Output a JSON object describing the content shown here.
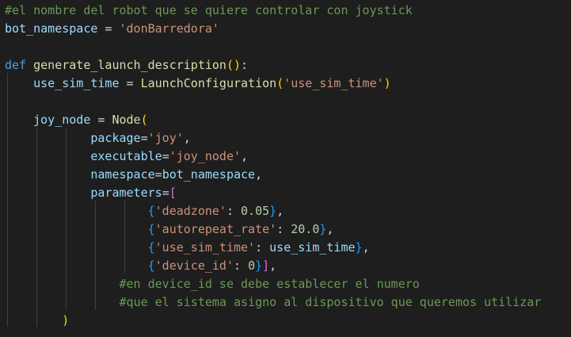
{
  "colors": {
    "background": "#1e1e1e",
    "keyword": "#569cd6",
    "function": "#dcdcaa",
    "variable": "#9cdcfe",
    "string": "#ce9178",
    "number": "#b5cea8",
    "comment": "#6a9955",
    "bracket_level_1": "#ffd700",
    "bracket_level_2": "#da70d6",
    "bracket_level_3": "#179fff"
  },
  "code": {
    "l1_comment": "#el nombre del robot que se quiere controlar con joystick",
    "l2_var": "bot_namespace",
    "l2_eq": " = ",
    "l2_str": "'donBarredora'",
    "l4_kw": "def",
    "l4_sp": " ",
    "l4_fn": "generate_launch_description",
    "l4_open": "(",
    "l4_close": ")",
    "l4_colon": ":",
    "l5_indent": "    ",
    "l5_var": "use_sim_time",
    "l5_eq": " = ",
    "l5_fn": "LaunchConfiguration",
    "l5_open": "(",
    "l5_str": "'use_sim_time'",
    "l5_close": ")",
    "l7_indent": "    ",
    "l7_var": "joy_node",
    "l7_eq": " = ",
    "l7_fn": "Node",
    "l7_open": "(",
    "l8_indent": "            ",
    "l8_var": "package",
    "l8_eq": "=",
    "l8_str": "'joy'",
    "l8_comma": ",",
    "l9_indent": "            ",
    "l9_var": "executable",
    "l9_eq": "=",
    "l9_str": "'joy_node'",
    "l9_comma": ",",
    "l10_indent": "            ",
    "l10_var": "namespace",
    "l10_eq": "=",
    "l10_val": "bot_namespace",
    "l10_comma": ",",
    "l11_indent": "            ",
    "l11_var": "parameters",
    "l11_eq": "=",
    "l11_open": "[",
    "l12_indent": "                    ",
    "l12_open": "{",
    "l12_str": "'deadzone'",
    "l12_colon": ": ",
    "l12_num": "0.05",
    "l12_close": "}",
    "l12_comma": ",",
    "l13_indent": "                    ",
    "l13_open": "{",
    "l13_str": "'autorepeat_rate'",
    "l13_colon": ": ",
    "l13_num": "20.0",
    "l13_close": "}",
    "l13_comma": ",",
    "l14_indent": "                    ",
    "l14_open": "{",
    "l14_str": "'use_sim_time'",
    "l14_colon": ": ",
    "l14_var": "use_sim_time",
    "l14_close": "}",
    "l14_comma": ",",
    "l15_indent": "                    ",
    "l15_open": "{",
    "l15_str": "'device_id'",
    "l15_colon": ": ",
    "l15_num": "0",
    "l15_close": "}",
    "l15_close2": "]",
    "l15_comma": ",",
    "l16_indent": "                ",
    "l16_comment": "#en device_id se debe establecer el numero",
    "l17_indent": "                ",
    "l17_comment": "#que el sistema asigno al dispositivo que queremos utilizar",
    "l18_indent": "        ",
    "l18_close": ")"
  }
}
